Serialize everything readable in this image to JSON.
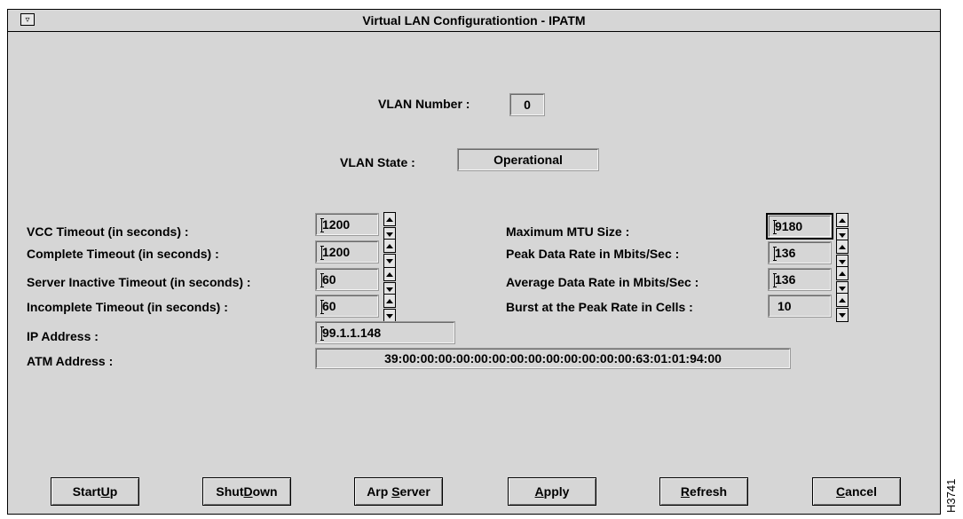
{
  "window": {
    "title": "Virtual LAN Configurationtion - IPATM",
    "system_menu_glyph": "▿"
  },
  "vlan_number": {
    "label": "VLAN Number :",
    "value": "0"
  },
  "vlan_state": {
    "label": "VLAN State :",
    "value": "Operational"
  },
  "left_fields": {
    "vcc_timeout": {
      "label": "VCC Timeout (in seconds) :",
      "value": "1200"
    },
    "complete_timeout": {
      "label": "Complete Timeout (in seconds) :",
      "value": "1200"
    },
    "server_inactive_timeout": {
      "label": "Server Inactive Timeout (in seconds) :",
      "value": "60"
    },
    "incomplete_timeout": {
      "label": "Incomplete Timeout (in seconds) :",
      "value": "60"
    },
    "ip_address": {
      "label": "IP Address :",
      "value": "99.1.1.148"
    },
    "atm_address": {
      "label": "ATM Address :",
      "value": "39:00:00:00:00:00:00:00:00:00:00:00:00:00:63:01:01:94:00"
    }
  },
  "right_fields": {
    "max_mtu": {
      "label": "Maximum MTU Size :",
      "value": "9180"
    },
    "peak_rate": {
      "label": "Peak Data Rate in Mbits/Sec :",
      "value": "136"
    },
    "avg_rate": {
      "label": "Average Data Rate in Mbits/Sec :",
      "value": "136"
    },
    "burst": {
      "label": "Burst at the Peak Rate in Cells :",
      "value": "10"
    }
  },
  "buttons": {
    "startup": {
      "pre": "Start",
      "mn": "U",
      "post": "p"
    },
    "shutdown": {
      "pre": "Shut",
      "mn": "D",
      "post": "own"
    },
    "arp_server": {
      "pre": "Arp ",
      "mn": "S",
      "post": "erver"
    },
    "apply": {
      "pre": "",
      "mn": "A",
      "post": "pply"
    },
    "refresh": {
      "pre": "",
      "mn": "R",
      "post": "efresh"
    },
    "cancel": {
      "pre": "",
      "mn": "C",
      "post": "ancel"
    }
  },
  "figure_id": "H3741"
}
